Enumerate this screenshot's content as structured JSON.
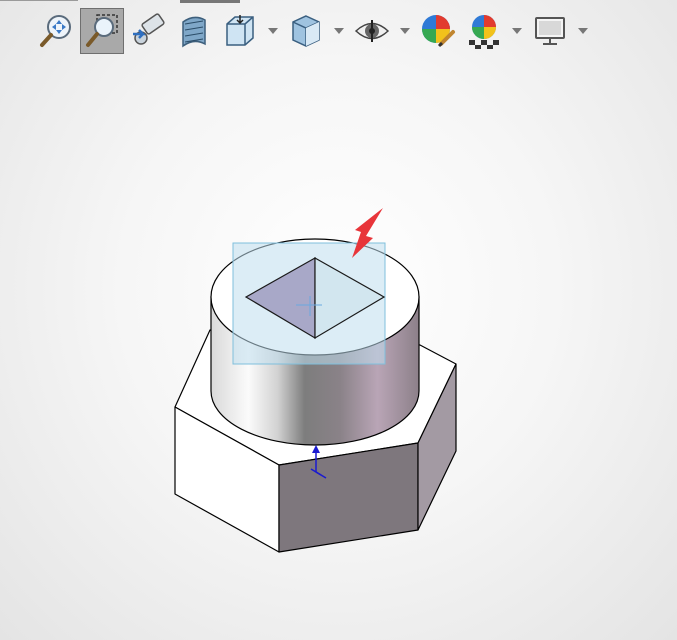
{
  "window": {
    "background_center": "#ffffff",
    "background_edge": "#e4e4e4"
  },
  "toolbar": {
    "buttons": [
      {
        "icon": "zoom-to-fit-icon",
        "active": false,
        "has_dropdown": false
      },
      {
        "icon": "zoom-to-area-icon",
        "active": true,
        "has_dropdown": false
      },
      {
        "icon": "previous-view-icon",
        "active": false,
        "has_dropdown": false
      },
      {
        "icon": "section-view-icon",
        "active": false,
        "has_dropdown": false
      },
      {
        "icon": "view-orientation-icon",
        "active": false,
        "has_dropdown": true
      },
      {
        "icon": "display-style-icon",
        "active": false,
        "has_dropdown": true
      },
      {
        "icon": "hide-show-items-icon",
        "active": false,
        "has_dropdown": true
      },
      {
        "icon": "edit-appearance-icon",
        "active": false,
        "has_dropdown": false
      },
      {
        "icon": "apply-scene-icon",
        "active": false,
        "has_dropdown": true
      },
      {
        "icon": "view-settings-icon",
        "active": false,
        "has_dropdown": true
      }
    ]
  },
  "model": {
    "description_colors": {
      "hex_top": "#ffffff",
      "hex_side_front": "#7e777d",
      "hex_side_right": "#a39aa3",
      "selection_fill": "#bfdfee",
      "triad_blue": "#1a1ad0",
      "annotation_arrow": "#e8353a"
    }
  }
}
